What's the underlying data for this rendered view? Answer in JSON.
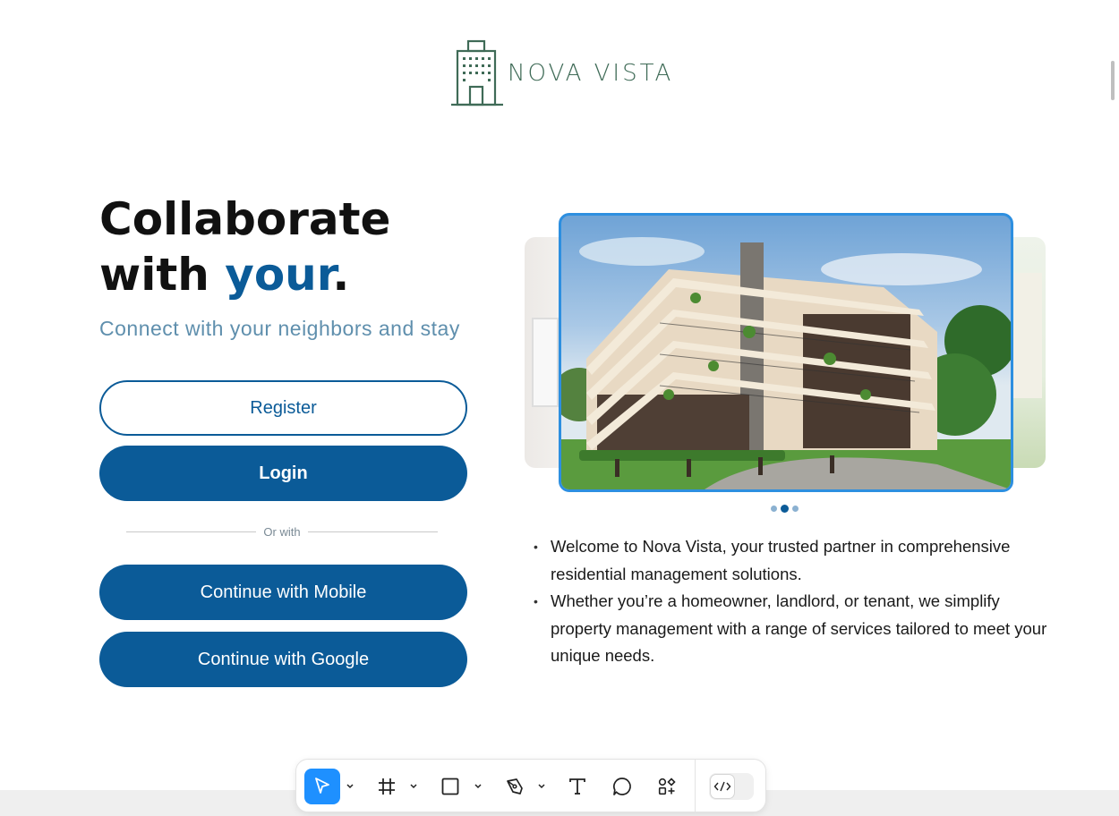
{
  "brand": {
    "name": "NOVA VISTA",
    "color": "#3f6b57"
  },
  "hero": {
    "title_line1": "Collaborate",
    "title_line2_prefix": "with ",
    "title_line2_accent": "your",
    "title_line2_suffix": ".",
    "subtitle": "Connect with your neighbors and stay"
  },
  "auth": {
    "register_label": "Register",
    "login_label": "Login",
    "divider_label": "Or with",
    "mobile_label": "Continue with Mobile",
    "google_label": "Continue with Google"
  },
  "carousel": {
    "slide_count": 3,
    "active_slide": 2
  },
  "bullets": [
    "Welcome to Nova Vista, your trusted partner in comprehensive residential management solutions.",
    "Whether you’re a homeowner, landlord, or tenant, we simplify property management with a range of services tailored to meet your unique needs."
  ],
  "toolbar": {
    "tools": [
      "move-icon",
      "frame-icon",
      "rectangle-icon",
      "pen-icon",
      "text-icon",
      "comment-icon",
      "actions-icon",
      "code-icon"
    ],
    "active_tool": "move-icon"
  },
  "colors": {
    "primary": "#0b5b98",
    "accent_blue": "#1e90ff",
    "subtitle": "#5f8fad"
  }
}
